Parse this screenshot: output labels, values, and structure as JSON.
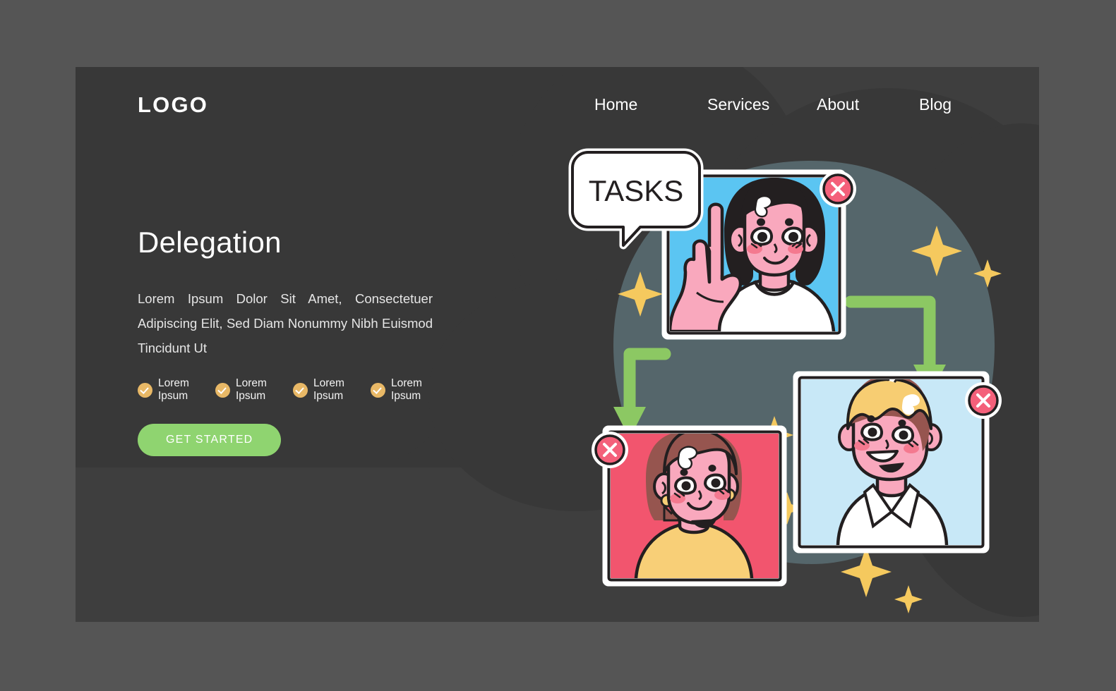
{
  "page": {
    "background_outer": "#555555",
    "background_panel": "#3e3e3e",
    "background_slab": "#383838"
  },
  "header": {
    "logo": "LOGO",
    "nav": [
      {
        "label": "Home"
      },
      {
        "label": "Services"
      },
      {
        "label": "About"
      },
      {
        "label": "Blog"
      }
    ]
  },
  "hero": {
    "title": "Delegation",
    "description": "Lorem Ipsum Dolor Sit Amet, Consectetuer Adipiscing Elit, Sed Diam Nonummy Nibh Euismod Tincidunt Ut",
    "features": [
      {
        "label": "Lorem Ipsum",
        "icon": "check-circle-icon"
      },
      {
        "label": "Lorem Ipsum",
        "icon": "check-circle-icon"
      },
      {
        "label": "Lorem Ipsum",
        "icon": "check-circle-icon"
      },
      {
        "label": "Lorem Ipsum",
        "icon": "check-circle-icon"
      }
    ],
    "cta_label": "GET STARTED",
    "cta_color": "#8fd470",
    "check_color": "#e8b866"
  },
  "illustration": {
    "speech_bubble_text": "TASKS",
    "blob_color": "#55666b",
    "cards": [
      {
        "name": "video-card-woman-dark-hair",
        "background": "#5bc5f2",
        "close_badge": "close-x-icon"
      },
      {
        "name": "video-card-man-blond",
        "background": "#c8e8f7",
        "close_badge": "close-x-icon"
      },
      {
        "name": "video-card-woman-brown-hair",
        "background": "#f2556e",
        "close_badge": "close-x-icon"
      }
    ],
    "arrows": [
      {
        "name": "arrow-down-left",
        "color": "#8cc863"
      },
      {
        "name": "arrow-down-right",
        "color": "#8cc863"
      }
    ],
    "sparkle_color": "#f5c95e",
    "close_badge_color": "#f4607a",
    "skin_color": "#f9a8bd",
    "hair_dark": "#231f20",
    "hair_blond": "#f7cd72",
    "hair_brown": "#96554f",
    "shirt_yellow": "#f8cf77"
  }
}
